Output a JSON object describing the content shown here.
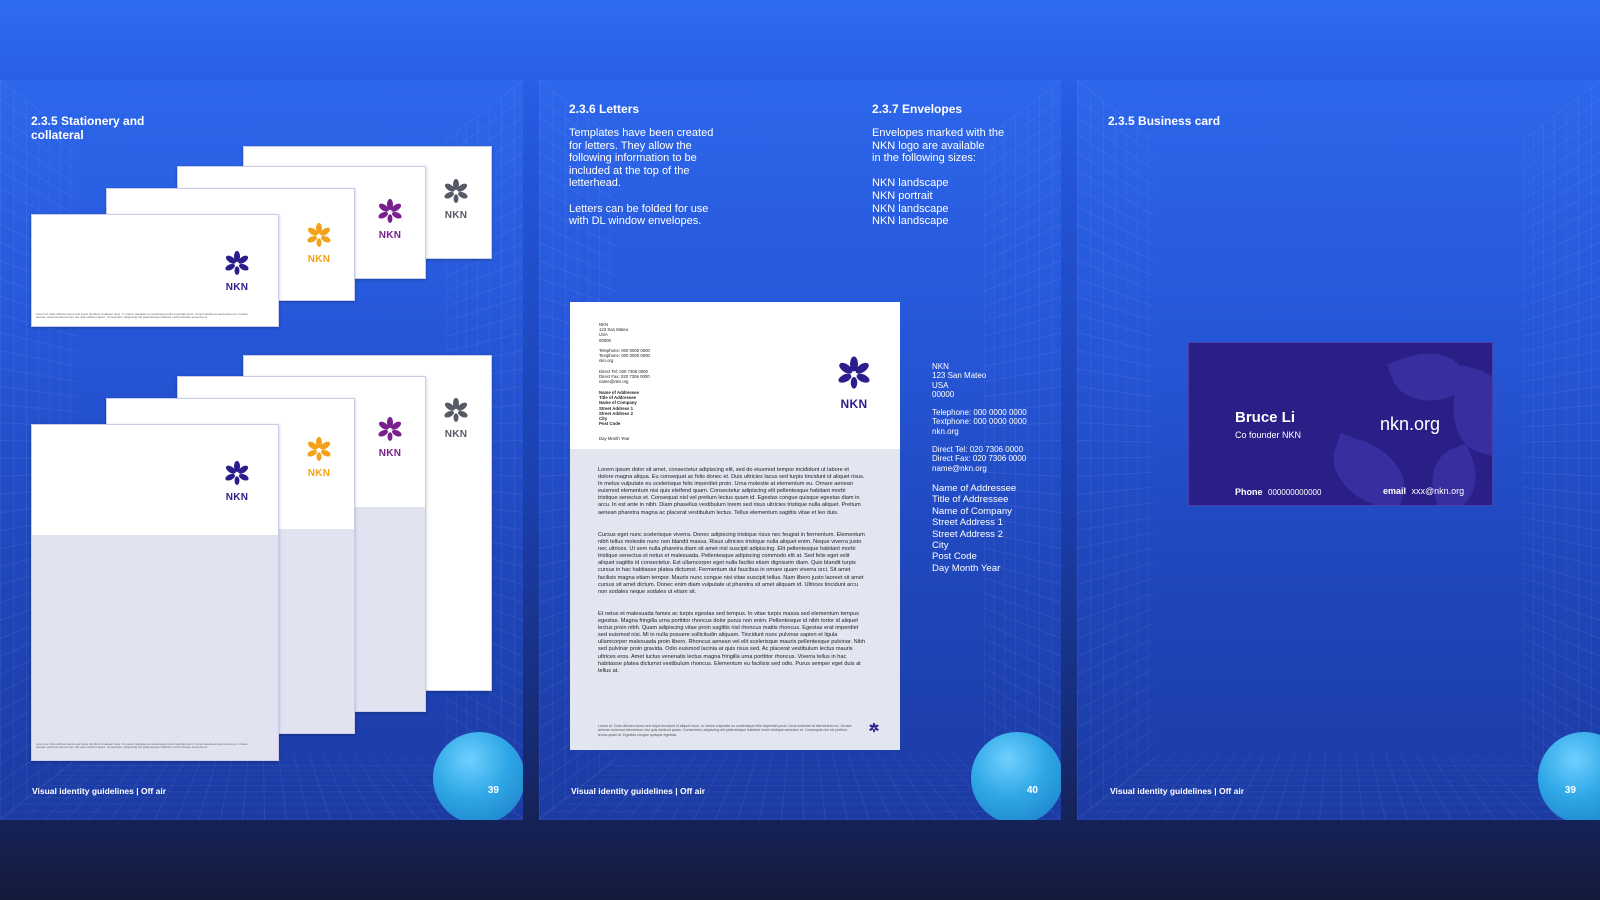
{
  "page1": {
    "heading": "2.3.5 Stationery and\ncollateral",
    "logo_word": "NKN",
    "fine_print": "Lorem et. Duis ultricies lacus sed turpis tincidunt id aliquet risus. In metus vulputate eu scelerisque felis imperdiet proin. Urna molestie at elementum eu. Ornare aenean euismod elementum nisi quis eleifend quam. Consectetur adipiscing elit pellentesque habitant morbi tristique senectus et.",
    "footer": "Visual identity guidelines | Off air",
    "page_number": "39"
  },
  "page2": {
    "letters_heading": "2.3.6 Letters",
    "letters_text": "Templates have been created\nfor letters. They allow the\nfollowing information to be\nincluded at the top of the\nletterhead.\n\nLetters can be folded for use\nwith DL window envelopes.",
    "envelopes_heading": "2.3.7 Envelopes",
    "envelopes_text": "Envelopes marked with the\nNKN logo are available\nin the following sizes:\n\nNKN landscape\nNKN portrait\nNKN landscape\nNKN landscape",
    "letter": {
      "sender": "NKN\n123 San Mateo\nUSA\n00000",
      "phones": "Telephone: 000 0000 0000\nTextphone: 000 0000 0000\nnkn.org",
      "direct": "Direct Tel: 020 7306 0000\nDirect Fax: 020 7306 0000\nname@nkn.org",
      "addressee": "Name of Addressee\nTitle of Addressee\nName of Company\nStreet Address 1\nStreet Address 2\nCity\nPost Code",
      "date": "Day Month Year",
      "logo_word": "NKN",
      "para1": "Lorem ipsum dolor sit amet, consectetur adipiscing elit, sed do eiusmod tempor incididunt ut labore et dolore magna aliqua. Eu consequat ac felis donec et. Duis ultricies lacus sed turpis tincidunt id aliquet risus. In metus vulputate eu scelerisque felis imperdiet proin. Urna molestie at elementum eu. Ornare aenean euismod elementum nisi quis eleifend quam. Consectetur adipiscing elit pellentesque habitant morbi tristique senectus et. Consequat nisl vel pretium lectus quam id. Egestas congue quisque egestas diam in arcu. In est ante in nibh. Diam phasellus vestibulum lorem sed risus ultricies tristique nulla aliquet. Pretium aenean pharetra magna ac placerat vestibulum lectus. Tellus elementum sagittis vitae et leo duis.",
      "para2": "Cursus eget nunc scelerisque viverra. Donec adipiscing tristique risus nec feugiat in fermentum. Elementum nibh tellus molestie nunc non blandit massa. Risus ultricies tristique nulla aliquet enim. Neque viverra justo nec ultrices. Ut sem nulla pharetra diam sit amet nisl suscipit adipiscing. Elit pellentesque habitant morbi tristique senectus et netus et malesuada. Pellentesque adipiscing commodo elit at. Sed felis eget velit aliquet sagittis id consectetur. Est ullamcorper eget nulla facilisi etiam dignissim diam. Quis blandit turpis cursus in hac habitasse platea dictumst. Fermentum dui faucibus in ornare quam viverra orci. Sit amet facilisis magna etiam tempor. Mauris nunc congue nisi vitae suscipit tellus. Nam libero justo laoreet sit amet cursus sit amet dictum. Donec enim diam vulputate ut pharetra sit amet aliquam id. Ultrices tincidunt arcu non sodales neque sodales ut etiam sit.",
      "para3": "Et netus et malesuada fames ac turpis egestas sed tempus. In vitae turpis massa sed elementum tempus egestas. Magna fringilla urna porttitor rhoncus dolor purus non enim. Pellentesque id nibh tortor id aliquet lectus proin nibh. Quam adipiscing vitae proin sagittis nisl rhoncus mattis rhoncus. Egestas erat imperdiet sed euismod nisi. Mi in nulla posuere sollicitudin aliquam. Tincidunt nunc pulvinar sapien et ligula ullamcorper malesuada proin libero. Rhoncus aenean vel elit scelerisque mauris pellentesque pulvinar. Nibh sed pulvinar proin gravida. Odio euismod lacinia at quis risus sed. Ac placerat vestibulum lectus mauris ultrices eros. Amet luctus venenatis lectus magna fringilla urna porttitor rhoncus. Viverra tellus in hac habitasse platea dictumst vestibulum rhoncus. Elementum eu facilisis sed odio. Purus semper eget duis at tellus at.",
      "fine_print": "Lorem et. Duis ultricies lacus sed turpis tincidunt id aliquet risus. In metus vulputate eu scelerisque felis imperdiet proin. Urna molestie at elementum eu. Ornare aenean euismod elementum nisi quis eleifend quam. Consectetur adipiscing elit pellentesque habitant morbi tristique senectus et. Consequat nisl vel pretium lectus quam id. Egestas congue quisque egestas."
    },
    "side_sender": "NKN\n123 San Mateo\nUSA\n00000",
    "side_phones": "Telephone: 000 0000 0000\nTextphone: 000 0000 0000\nnkn.org",
    "side_direct": "Direct Tel: 020 7306 0000\nDirect Fax: 020 7306 0000\nname@nkn.org",
    "side_addressee": "Name of Addressee\nTitle of Addressee\nName of Company\nStreet Address 1\nStreet Address 2\nCity\nPost Code\nDay Month Year",
    "footer": "Visual identity guidelines | Off air",
    "page_number": "40"
  },
  "page3": {
    "heading": "2.3.5 Business card",
    "card": {
      "name": "Bruce Li",
      "title": "Co founder NKN",
      "site": "nkn.org",
      "phone_label": "Phone",
      "phone_value": "000000000000",
      "email_label": "email",
      "email_value": "xxx@nkn.org"
    },
    "footer": "Visual identity guidelines | Off air",
    "page_number": "39"
  },
  "colors": {
    "logo_navy": "#2b1d8c",
    "logo_orange": "#f5a21b",
    "logo_purple": "#7a1f8e",
    "logo_gray": "#555a66",
    "card_bg": "#2a1f86"
  }
}
